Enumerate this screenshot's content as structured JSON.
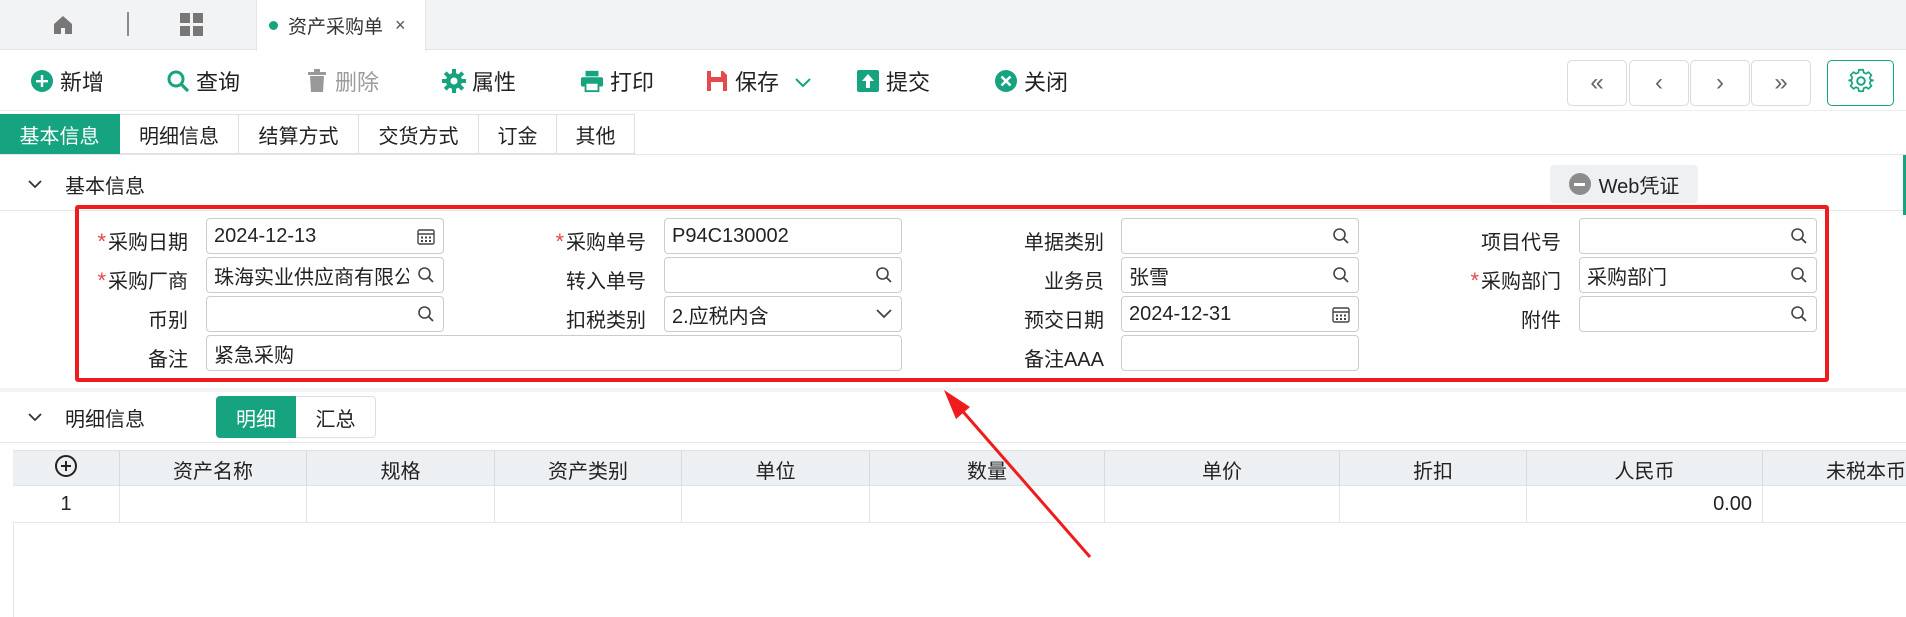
{
  "tabbar": {
    "home_icon": "home-icon",
    "apps_icon": "grid-icon",
    "active_tab": {
      "label": "资产采购单",
      "close": "×"
    }
  },
  "toolbar": {
    "new": "新增",
    "query": "查询",
    "delete": "删除",
    "properties": "属性",
    "print": "打印",
    "save": "保存",
    "submit": "提交",
    "close": "关闭"
  },
  "nav": {
    "first": "«",
    "prev": "‹",
    "next": "›",
    "last": "»"
  },
  "section_tabs": [
    "基本信息",
    "明细信息",
    "结算方式",
    "交货方式",
    "订金",
    "其他"
  ],
  "basic": {
    "title": "基本信息",
    "web_voucher": "Web凭证",
    "fields": {
      "purchase_date": {
        "label": "采购日期",
        "value": "2024-12-13"
      },
      "purchase_no": {
        "label": "采购单号",
        "value": "P94C130002"
      },
      "doc_type": {
        "label": "单据类别",
        "value": ""
      },
      "project_code": {
        "label": "项目代号",
        "value": ""
      },
      "supplier": {
        "label": "采购厂商",
        "value": "珠海实业供应商有限公司"
      },
      "transfer_no": {
        "label": "转入单号",
        "value": ""
      },
      "salesman": {
        "label": "业务员",
        "value": "张雪"
      },
      "purchase_dept": {
        "label": "采购部门",
        "value": "采购部门"
      },
      "currency": {
        "label": "币别",
        "value": ""
      },
      "tax_type": {
        "label": "扣税类别",
        "value": "2.应税内含"
      },
      "delivery_date": {
        "label": "预交日期",
        "value": "2024-12-31"
      },
      "attachment": {
        "label": "附件",
        "value": ""
      },
      "remark": {
        "label": "备注",
        "value": "紧急采购"
      },
      "remark_aaa": {
        "label": "备注AAA",
        "value": ""
      }
    }
  },
  "detail": {
    "title": "明细信息",
    "tabs": [
      "明细",
      "汇总"
    ],
    "columns": [
      "资产名称",
      "规格",
      "资产类别",
      "单位",
      "数量",
      "单价",
      "折扣",
      "人民币",
      "未税本币"
    ],
    "rows": [
      {
        "no": "1",
        "rmb": "0.00"
      }
    ]
  },
  "colors": {
    "accent": "#16a37f",
    "annotation": "#ee1c1c"
  }
}
